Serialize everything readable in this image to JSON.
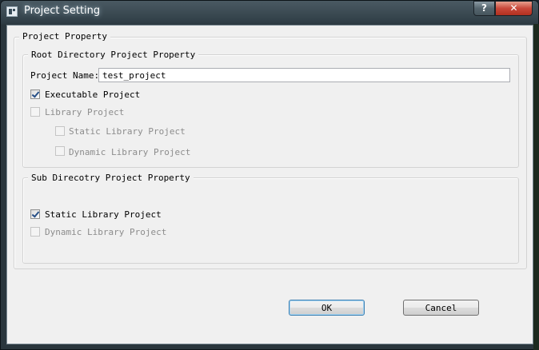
{
  "window": {
    "title": "Project Setting",
    "help_label": "?",
    "close_label": "✕"
  },
  "project_property": {
    "title": "Project  Property",
    "root": {
      "title": "Root Directory Project Property",
      "name_label": "Project Name:",
      "name_value": "test_project",
      "executable": {
        "label": "Executable Project",
        "checked": true,
        "enabled": true
      },
      "library": {
        "label": "Library Project",
        "checked": false,
        "enabled": false
      },
      "static_library": {
        "label": "Static Library Project",
        "checked": false,
        "enabled": false
      },
      "dynamic_library": {
        "label": "Dynamic Library Project",
        "checked": false,
        "enabled": false
      }
    },
    "sub": {
      "title": "Sub Direcotry Project Property",
      "static_library": {
        "label": "Static Library Project",
        "checked": true,
        "enabled": true
      },
      "dynamic_library": {
        "label": "Dynamic Library Project",
        "checked": false,
        "enabled": false
      }
    }
  },
  "buttons": {
    "ok": "OK",
    "cancel": "Cancel"
  }
}
